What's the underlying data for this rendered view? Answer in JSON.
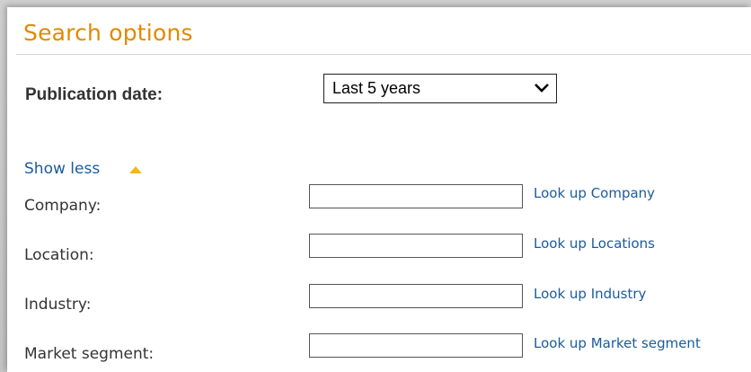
{
  "section": {
    "title": "Search options"
  },
  "publication_date": {
    "label": "Publication date:",
    "selected": "Last 5 years"
  },
  "toggle": {
    "label": "Show less"
  },
  "fields": [
    {
      "label": "Company:",
      "value": "",
      "link": "Look up Company"
    },
    {
      "label": "Location:",
      "value": "",
      "link": "Look up Locations"
    },
    {
      "label": "Industry:",
      "value": "",
      "link": "Look up Industry"
    },
    {
      "label": "Market segment:",
      "value": "",
      "link": "Look up Market segment"
    }
  ],
  "colors": {
    "title": "#e08a00",
    "link": "#1a5b9c",
    "toggle_icon": "#f3b71b"
  },
  "icons": {
    "select_arrow": "chevron-down-icon",
    "toggle": "triangle-up-icon"
  }
}
